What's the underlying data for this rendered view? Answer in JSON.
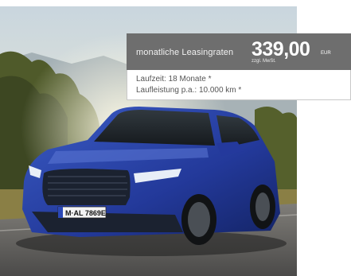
{
  "offer": {
    "price_label": "monatliche Leasingraten",
    "price_value": "339,00",
    "currency": "EUR",
    "vat_note": "zzgl. MwSt.",
    "term": "Laufzeit: 18 Monate *",
    "mileage": "Laufleistung p.a.: 10.000 km *"
  },
  "vehicle": {
    "license_plate": "M·AL 7869E"
  },
  "colors": {
    "header_bg": "#6e6e6e",
    "car_blue": "#2a45a8"
  }
}
